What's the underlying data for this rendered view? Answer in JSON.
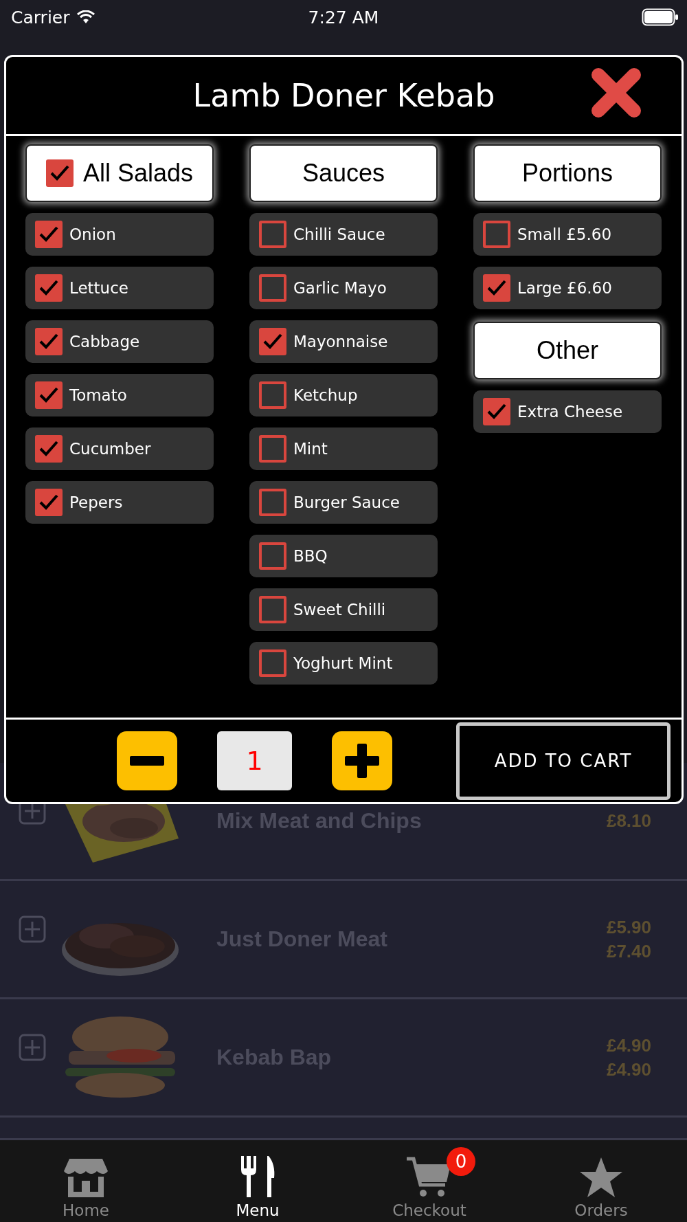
{
  "status_bar": {
    "carrier": "Carrier",
    "time": "7:27 AM"
  },
  "modal": {
    "title": "Lamb Doner Kebab",
    "columns": [
      {
        "sections": [
          {
            "title": "All Salads",
            "kind": "checkbox",
            "checked": true,
            "items": [
              {
                "label": "Onion",
                "checked": true
              },
              {
                "label": "Lettuce",
                "checked": true
              },
              {
                "label": "Cabbage",
                "checked": true
              },
              {
                "label": "Tomato",
                "checked": true
              },
              {
                "label": "Cucumber",
                "checked": true
              },
              {
                "label": "Pepers",
                "checked": true
              }
            ]
          }
        ]
      },
      {
        "sections": [
          {
            "title": "Sauces",
            "kind": "plain",
            "items": [
              {
                "label": "Chilli Sauce",
                "checked": false
              },
              {
                "label": "Garlic Mayo",
                "checked": false
              },
              {
                "label": "Mayonnaise",
                "checked": true
              },
              {
                "label": "Ketchup",
                "checked": false
              },
              {
                "label": "Mint",
                "checked": false
              },
              {
                "label": "Burger Sauce",
                "checked": false
              },
              {
                "label": "BBQ",
                "checked": false
              },
              {
                "label": "Sweet Chilli",
                "checked": false
              },
              {
                "label": "Yoghurt Mint",
                "checked": false
              }
            ]
          }
        ]
      },
      {
        "sections": [
          {
            "title": "Portions",
            "kind": "plain",
            "items": [
              {
                "label": "Small £5.60",
                "checked": false
              },
              {
                "label": "Large £6.60",
                "checked": true
              }
            ]
          },
          {
            "title": "Other",
            "kind": "plain",
            "items": [
              {
                "label": "Extra Cheese",
                "checked": true
              }
            ]
          }
        ]
      }
    ],
    "quantity": "1",
    "add_button": "ADD TO CART"
  },
  "menu_rows": [
    {
      "name": "Mix Meat and Chips",
      "prices": [
        "£8.10"
      ],
      "kind": "tray"
    },
    {
      "name": "Just Doner Meat",
      "prices": [
        "£5.90",
        "£7.40"
      ],
      "kind": "plate"
    },
    {
      "name": "Kebab Bap",
      "prices": [
        "£4.90",
        "£4.90"
      ],
      "kind": "burger"
    }
  ],
  "tab_bar": [
    {
      "label": "Home",
      "kind": "home",
      "selected": false
    },
    {
      "label": "Menu",
      "kind": "menu",
      "selected": true
    },
    {
      "label": "Checkout",
      "kind": "cart",
      "selected": false,
      "badge": "0"
    },
    {
      "label": "Orders",
      "kind": "star",
      "selected": false
    }
  ]
}
